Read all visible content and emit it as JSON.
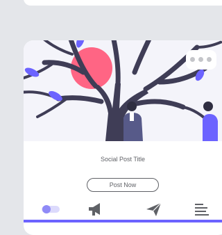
{
  "post": {
    "title": "Social Post Title",
    "button_label": "Post Now"
  },
  "tabbar": {
    "items": [
      {
        "icon": "toggle-icon"
      },
      {
        "icon": "megaphone-icon"
      },
      {
        "icon": "send-icon"
      },
      {
        "icon": "menu-lines-icon"
      }
    ]
  },
  "colors": {
    "accent": "#6c63ff",
    "sun": "#ff6584",
    "tree": "#3f3d56",
    "text": "#5f6166",
    "background": "#e4e6ea"
  }
}
